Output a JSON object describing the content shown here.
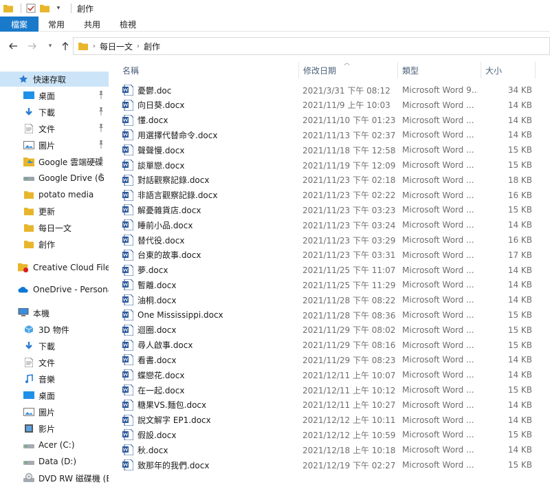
{
  "window": {
    "title": "創作"
  },
  "ribbon": {
    "tabs": [
      "檔案",
      "常用",
      "共用",
      "檢視"
    ]
  },
  "address": {
    "crumbs": [
      "每日一文",
      "創作"
    ]
  },
  "columns": {
    "name": "名稱",
    "date": "修改日期",
    "type": "類型",
    "size": "大小"
  },
  "colors": {
    "accent": "#1979ca",
    "selected": "#cce4f7",
    "word_blue": "#2b579a",
    "folder": "#e8b62c"
  },
  "sidebar": {
    "items": [
      {
        "label": "快速存取",
        "icon": "star-icon",
        "selected": true,
        "pinned": false,
        "indent": 26
      },
      {
        "label": "桌面",
        "icon": "desktop-icon",
        "pinned": true,
        "indent": 34
      },
      {
        "label": "下載",
        "icon": "download-icon",
        "pinned": true,
        "indent": 34
      },
      {
        "label": "文件",
        "icon": "document-icon",
        "pinned": true,
        "indent": 34
      },
      {
        "label": "圖片",
        "icon": "pictures-icon",
        "pinned": true,
        "indent": 34
      },
      {
        "label": "Google 雲端硬碟",
        "icon": "google-drive-icon",
        "pinned": true,
        "indent": 34
      },
      {
        "label": "Google Drive (G",
        "icon": "drive-icon",
        "pinned": true,
        "indent": 34
      },
      {
        "label": "potato media",
        "icon": "folder-icon",
        "pinned": false,
        "indent": 34
      },
      {
        "label": "更新",
        "icon": "folder-icon",
        "pinned": false,
        "indent": 34
      },
      {
        "label": "每日一文",
        "icon": "folder-icon",
        "pinned": false,
        "indent": 34
      },
      {
        "label": "創作",
        "icon": "folder-icon",
        "pinned": false,
        "indent": 34
      },
      {
        "label": "Creative Cloud Files",
        "icon": "creative-cloud-icon",
        "pinned": false,
        "indent": 26
      },
      {
        "label": "OneDrive - Personal",
        "icon": "onedrive-icon",
        "pinned": false,
        "indent": 26
      },
      {
        "label": "本機",
        "icon": "computer-icon",
        "pinned": false,
        "indent": 26
      },
      {
        "label": "3D 物件",
        "icon": "3d-objects-icon",
        "pinned": false,
        "indent": 34
      },
      {
        "label": "下載",
        "icon": "download-icon",
        "pinned": false,
        "indent": 34
      },
      {
        "label": "文件",
        "icon": "document-icon",
        "pinned": false,
        "indent": 34
      },
      {
        "label": "音樂",
        "icon": "music-icon",
        "pinned": false,
        "indent": 34
      },
      {
        "label": "桌面",
        "icon": "desktop-icon",
        "pinned": false,
        "indent": 34
      },
      {
        "label": "圖片",
        "icon": "pictures-icon",
        "pinned": false,
        "indent": 34
      },
      {
        "label": "影片",
        "icon": "video-icon",
        "pinned": false,
        "indent": 34
      },
      {
        "label": "Acer (C:)",
        "icon": "hard-drive-icon",
        "pinned": false,
        "indent": 34
      },
      {
        "label": "Data (D:)",
        "icon": "hard-drive-icon",
        "pinned": false,
        "indent": 34
      },
      {
        "label": "DVD RW 磁碟機 (E:",
        "icon": "dvd-drive-icon",
        "pinned": false,
        "indent": 34
      }
    ]
  },
  "files": [
    {
      "name": "憂鬱.doc",
      "date": "2021/3/31 下午 08:12",
      "type": "Microsoft Word 9...",
      "size": "34 KB"
    },
    {
      "name": "向日葵.docx",
      "date": "2021/11/9 上午 10:03",
      "type": "Microsoft Word ...",
      "size": "14 KB"
    },
    {
      "name": "懂.docx",
      "date": "2021/11/10 下午 01:23",
      "type": "Microsoft Word ...",
      "size": "14 KB"
    },
    {
      "name": "用選擇代替命令.docx",
      "date": "2021/11/13 下午 02:37",
      "type": "Microsoft Word ...",
      "size": "14 KB"
    },
    {
      "name": "聲聲慢.docx",
      "date": "2021/11/18 下午 12:58",
      "type": "Microsoft Word ...",
      "size": "15 KB"
    },
    {
      "name": "談單戀.docx",
      "date": "2021/11/19 下午 12:09",
      "type": "Microsoft Word ...",
      "size": "15 KB"
    },
    {
      "name": "對話觀察記錄.docx",
      "date": "2021/11/23 下午 02:18",
      "type": "Microsoft Word ...",
      "size": "18 KB"
    },
    {
      "name": "非語言觀察記錄.docx",
      "date": "2021/11/23 下午 02:22",
      "type": "Microsoft Word ...",
      "size": "16 KB"
    },
    {
      "name": "解憂雜貨店.docx",
      "date": "2021/11/23 下午 03:23",
      "type": "Microsoft Word ...",
      "size": "15 KB"
    },
    {
      "name": "睡前小品.docx",
      "date": "2021/11/23 下午 03:24",
      "type": "Microsoft Word ...",
      "size": "14 KB"
    },
    {
      "name": "替代役.docx",
      "date": "2021/11/23 下午 03:29",
      "type": "Microsoft Word ...",
      "size": "16 KB"
    },
    {
      "name": "台東的故事.docx",
      "date": "2021/11/23 下午 03:31",
      "type": "Microsoft Word ...",
      "size": "17 KB"
    },
    {
      "name": "夢.docx",
      "date": "2021/11/25 下午 11:07",
      "type": "Microsoft Word ...",
      "size": "14 KB"
    },
    {
      "name": "暫離.docx",
      "date": "2021/11/25 下午 11:29",
      "type": "Microsoft Word ...",
      "size": "14 KB"
    },
    {
      "name": "油桐.docx",
      "date": "2021/11/28 下午 08:22",
      "type": "Microsoft Word ...",
      "size": "14 KB"
    },
    {
      "name": "One Mississippi.docx",
      "date": "2021/11/28 下午 08:36",
      "type": "Microsoft Word ...",
      "size": "15 KB"
    },
    {
      "name": "迴圈.docx",
      "date": "2021/11/29 下午 08:02",
      "type": "Microsoft Word ...",
      "size": "15 KB"
    },
    {
      "name": "尋人啟事.docx",
      "date": "2021/11/29 下午 08:16",
      "type": "Microsoft Word ...",
      "size": "15 KB"
    },
    {
      "name": "看書.docx",
      "date": "2021/11/29 下午 08:23",
      "type": "Microsoft Word ...",
      "size": "14 KB"
    },
    {
      "name": "蝶戀花.docx",
      "date": "2021/12/11 上午 10:07",
      "type": "Microsoft Word ...",
      "size": "14 KB"
    },
    {
      "name": "在一起.docx",
      "date": "2021/12/11 上午 10:12",
      "type": "Microsoft Word ...",
      "size": "15 KB"
    },
    {
      "name": "糖果VS.麵包.docx",
      "date": "2021/12/11 上午 10:27",
      "type": "Microsoft Word ...",
      "size": "14 KB"
    },
    {
      "name": "說文解字 EP1.docx",
      "date": "2021/12/12 上午 10:11",
      "type": "Microsoft Word ...",
      "size": "14 KB"
    },
    {
      "name": "假設.docx",
      "date": "2021/12/12 上午 10:59",
      "type": "Microsoft Word ...",
      "size": "15 KB"
    },
    {
      "name": "秋.docx",
      "date": "2021/12/18 上午 10:18",
      "type": "Microsoft Word ...",
      "size": "14 KB"
    },
    {
      "name": "致那年的我們.docx",
      "date": "2021/12/19 下午 02:27",
      "type": "Microsoft Word ...",
      "size": "15 KB"
    }
  ]
}
